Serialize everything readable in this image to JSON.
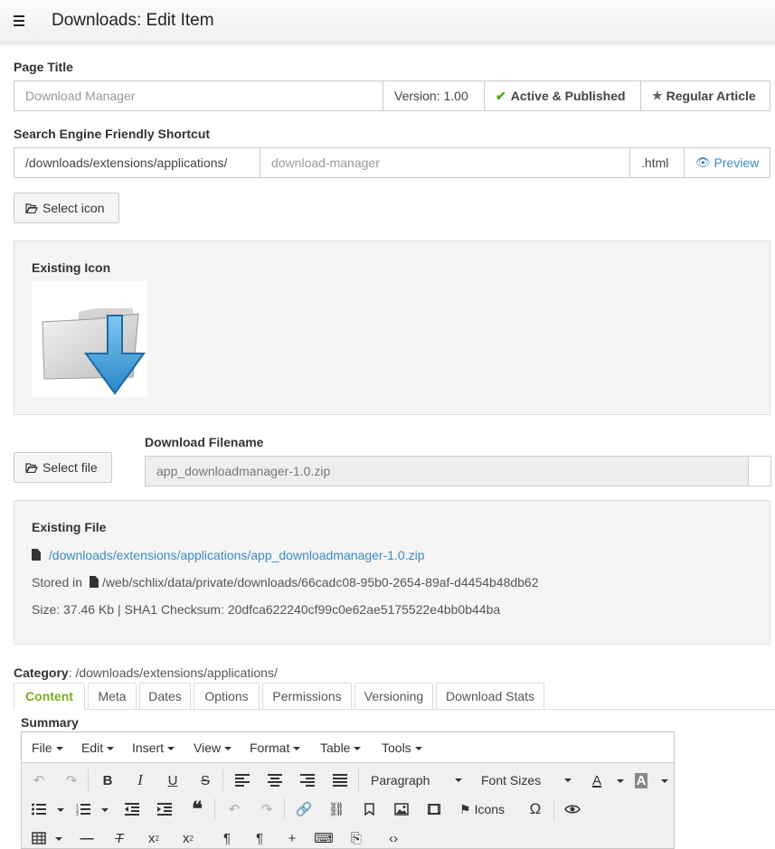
{
  "header": {
    "title": "Downloads: Edit Item"
  },
  "page_title": {
    "label": "Page Title",
    "placeholder": "Download Manager",
    "version": "Version: 1.00",
    "status": "Active & Published",
    "type": "Regular Article"
  },
  "sef": {
    "label": "Search Engine Friendly Shortcut",
    "prefix": "/downloads/extensions/applications/",
    "placeholder": "download-manager",
    "suffix": ".html",
    "preview": "Preview"
  },
  "icon": {
    "select_button": "Select icon",
    "existing_label": "Existing Icon"
  },
  "file": {
    "select_button": "Select file",
    "filename_label": "Download Filename",
    "filename_value": "app_downloadmanager-1.0.zip",
    "existing_label": "Existing File",
    "link": "/downloads/extensions/applications/app_downloadmanager-1.0.zip",
    "stored_prefix": "Stored in",
    "stored_path": "/web/schlix/data/private/downloads/66cadc08-95b0-2654-89af-d4454b48db62",
    "size_line": "Size: 37.46 Kb | SHA1 Checksum: 20dfca622240cf99c0e62ae5175522e4bb0b44ba"
  },
  "category": {
    "label": "Category",
    "value": ": /downloads/extensions/applications/"
  },
  "tabs": [
    {
      "label": "Content"
    },
    {
      "label": "Meta"
    },
    {
      "label": "Dates"
    },
    {
      "label": "Options"
    },
    {
      "label": "Permissions"
    },
    {
      "label": "Versioning"
    },
    {
      "label": "Download Stats"
    }
  ],
  "summary": {
    "label": "Summary"
  },
  "editor": {
    "menus": [
      "File",
      "Edit",
      "Insert",
      "View",
      "Format",
      "Table",
      "Tools"
    ],
    "format_select": "Paragraph",
    "size_select": "Font Sizes",
    "icons_button": "Icons"
  },
  "colors": {
    "accent_green": "#7cac1c",
    "link_blue": "#3a8bc2",
    "check_green": "#4cae1c"
  }
}
